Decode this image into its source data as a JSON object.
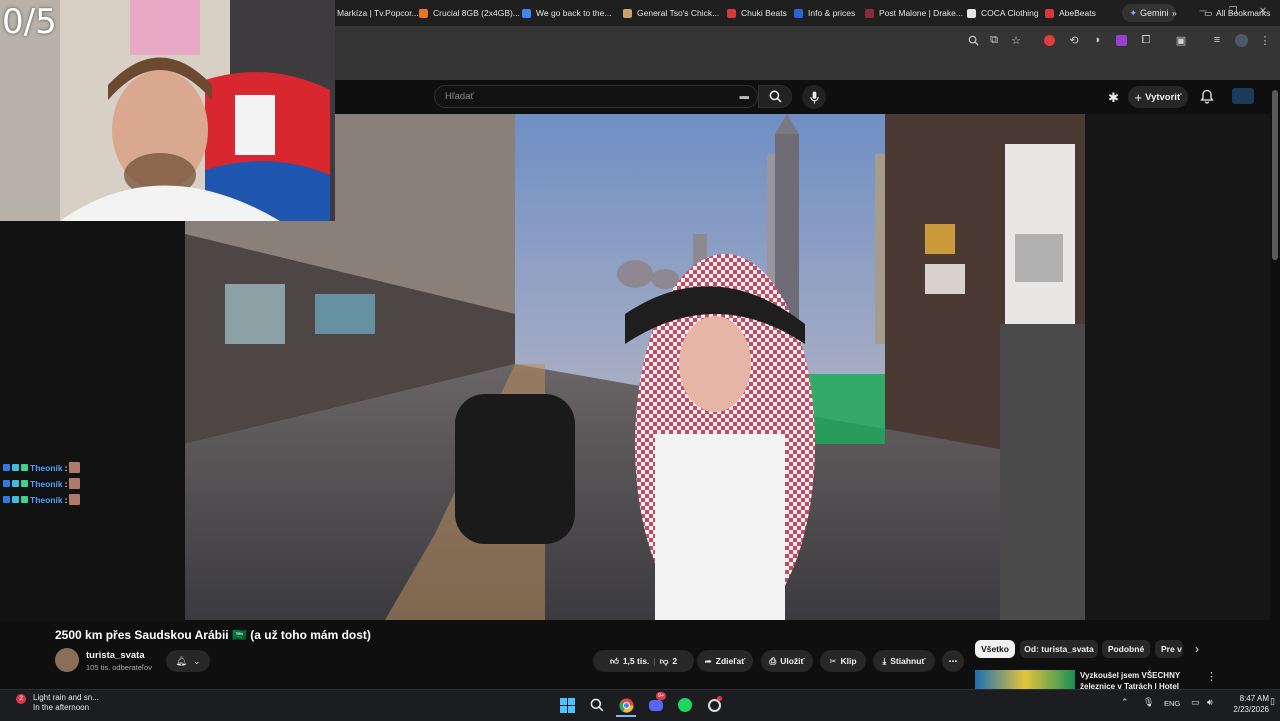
{
  "overlay": {
    "counter": "0/5"
  },
  "chrome": {
    "gemini_label": "Gemini",
    "bookmarks": [
      {
        "label": "Markíza | Tv.Popcor...",
        "color": "#3b6ccf"
      },
      {
        "label": "Crucial 8GB (2x4GB)...",
        "color": "#e8742a"
      },
      {
        "label": "We go back to the...",
        "color": "#4285f4"
      },
      {
        "label": "General Tso's Chick...",
        "color": "#c9a26a"
      },
      {
        "label": "Chuki Beats",
        "color": "#d33b3b"
      },
      {
        "label": "Info & prices",
        "color": "#2d62d6"
      },
      {
        "label": "Post Malone | Drake...",
        "color": "#8a2c3c"
      },
      {
        "label": "COCA Clothing",
        "color": "#e6e6e6"
      },
      {
        "label": "AbeBeats",
        "color": "#d33b3b"
      }
    ],
    "all_bookmarks_label": "All Bookmarks"
  },
  "youtube": {
    "search_placeholder": "Hľadať",
    "create_label": "Vytvoriť",
    "video_title": "2500 km přes Saudskou Arábii 🇸🇦 (a už toho mám dost)",
    "channel_name": "turista_svata",
    "subscribers": "105 tis. odberateľov",
    "likes": "1,5 tis.",
    "dislikes": "2",
    "share_label": "Zdieľať",
    "save_label": "Uložiť",
    "clip_label": "Klip",
    "download_label": "Stiahnuť",
    "chips": [
      "Všetko",
      "Od: turista_svata",
      "Podobné",
      "Pre v"
    ],
    "recommended_title": "Vyzkoušel jsem VŠECHNY železnice v Tatrách | Hotel"
  },
  "chat": [
    {
      "user": "Theonik",
      "sep": ":"
    },
    {
      "user": "Theonik",
      "sep": ":"
    },
    {
      "user": "Theonik",
      "sep": ":"
    }
  ],
  "taskbar": {
    "weather_line1": "Light rain and sn...",
    "weather_line2": "In the afternoon",
    "weather_badge": "2",
    "language": "ENG",
    "time": "8:47 AM",
    "date": "2/23/2026",
    "discord_badge": "9+"
  },
  "colors": {
    "accent_red": "#ff0000",
    "chat_name": "#4aa3ff",
    "chip_active": "#f1f1f1"
  }
}
